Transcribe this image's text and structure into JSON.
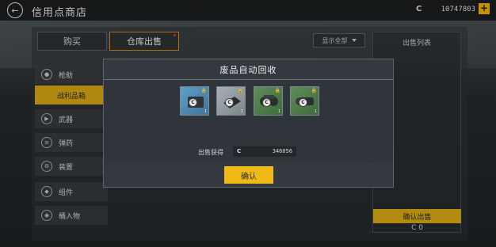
{
  "topbar": {
    "back_icon": "left-arrow-icon",
    "title": "信用点商店",
    "currency_symbol": "C",
    "balance": "10747803",
    "add_label": "+"
  },
  "tabs": [
    {
      "label": "购买"
    },
    {
      "label": "仓库出售"
    }
  ],
  "filter": {
    "label": "显示全部"
  },
  "sell_list": {
    "title": "出售列表",
    "confirm_label": "确认出售",
    "total": "C 0"
  },
  "sidebar": {
    "items": [
      {
        "label": "枪舫",
        "icon": "gun-icon"
      },
      {
        "label": "战利品箱"
      },
      {
        "label": "武器",
        "icon": "weapon-icon"
      },
      {
        "label": "弹药",
        "icon": "ammo-icon"
      },
      {
        "label": "装置",
        "icon": "gear-icon"
      },
      {
        "label": "组件",
        "icon": "component-icon"
      },
      {
        "label": "桶入物",
        "icon": "implant-icon"
      }
    ]
  },
  "modal": {
    "title": "废品自动回收",
    "items": [
      {
        "color": "#4f88b0",
        "qty": "1",
        "icon": "device-icon"
      },
      {
        "color": "#8f979c",
        "qty": "1",
        "icon": "chip-icon"
      },
      {
        "color": "#4f7b4b",
        "qty": "1",
        "icon": "goggles-icon"
      },
      {
        "color": "#4f7b4b",
        "qty": "1",
        "icon": "scope-icon"
      }
    ],
    "earn_label": "出售获得",
    "earn_currency": "C",
    "earn_value": "346056",
    "confirm_label": "确认"
  }
}
